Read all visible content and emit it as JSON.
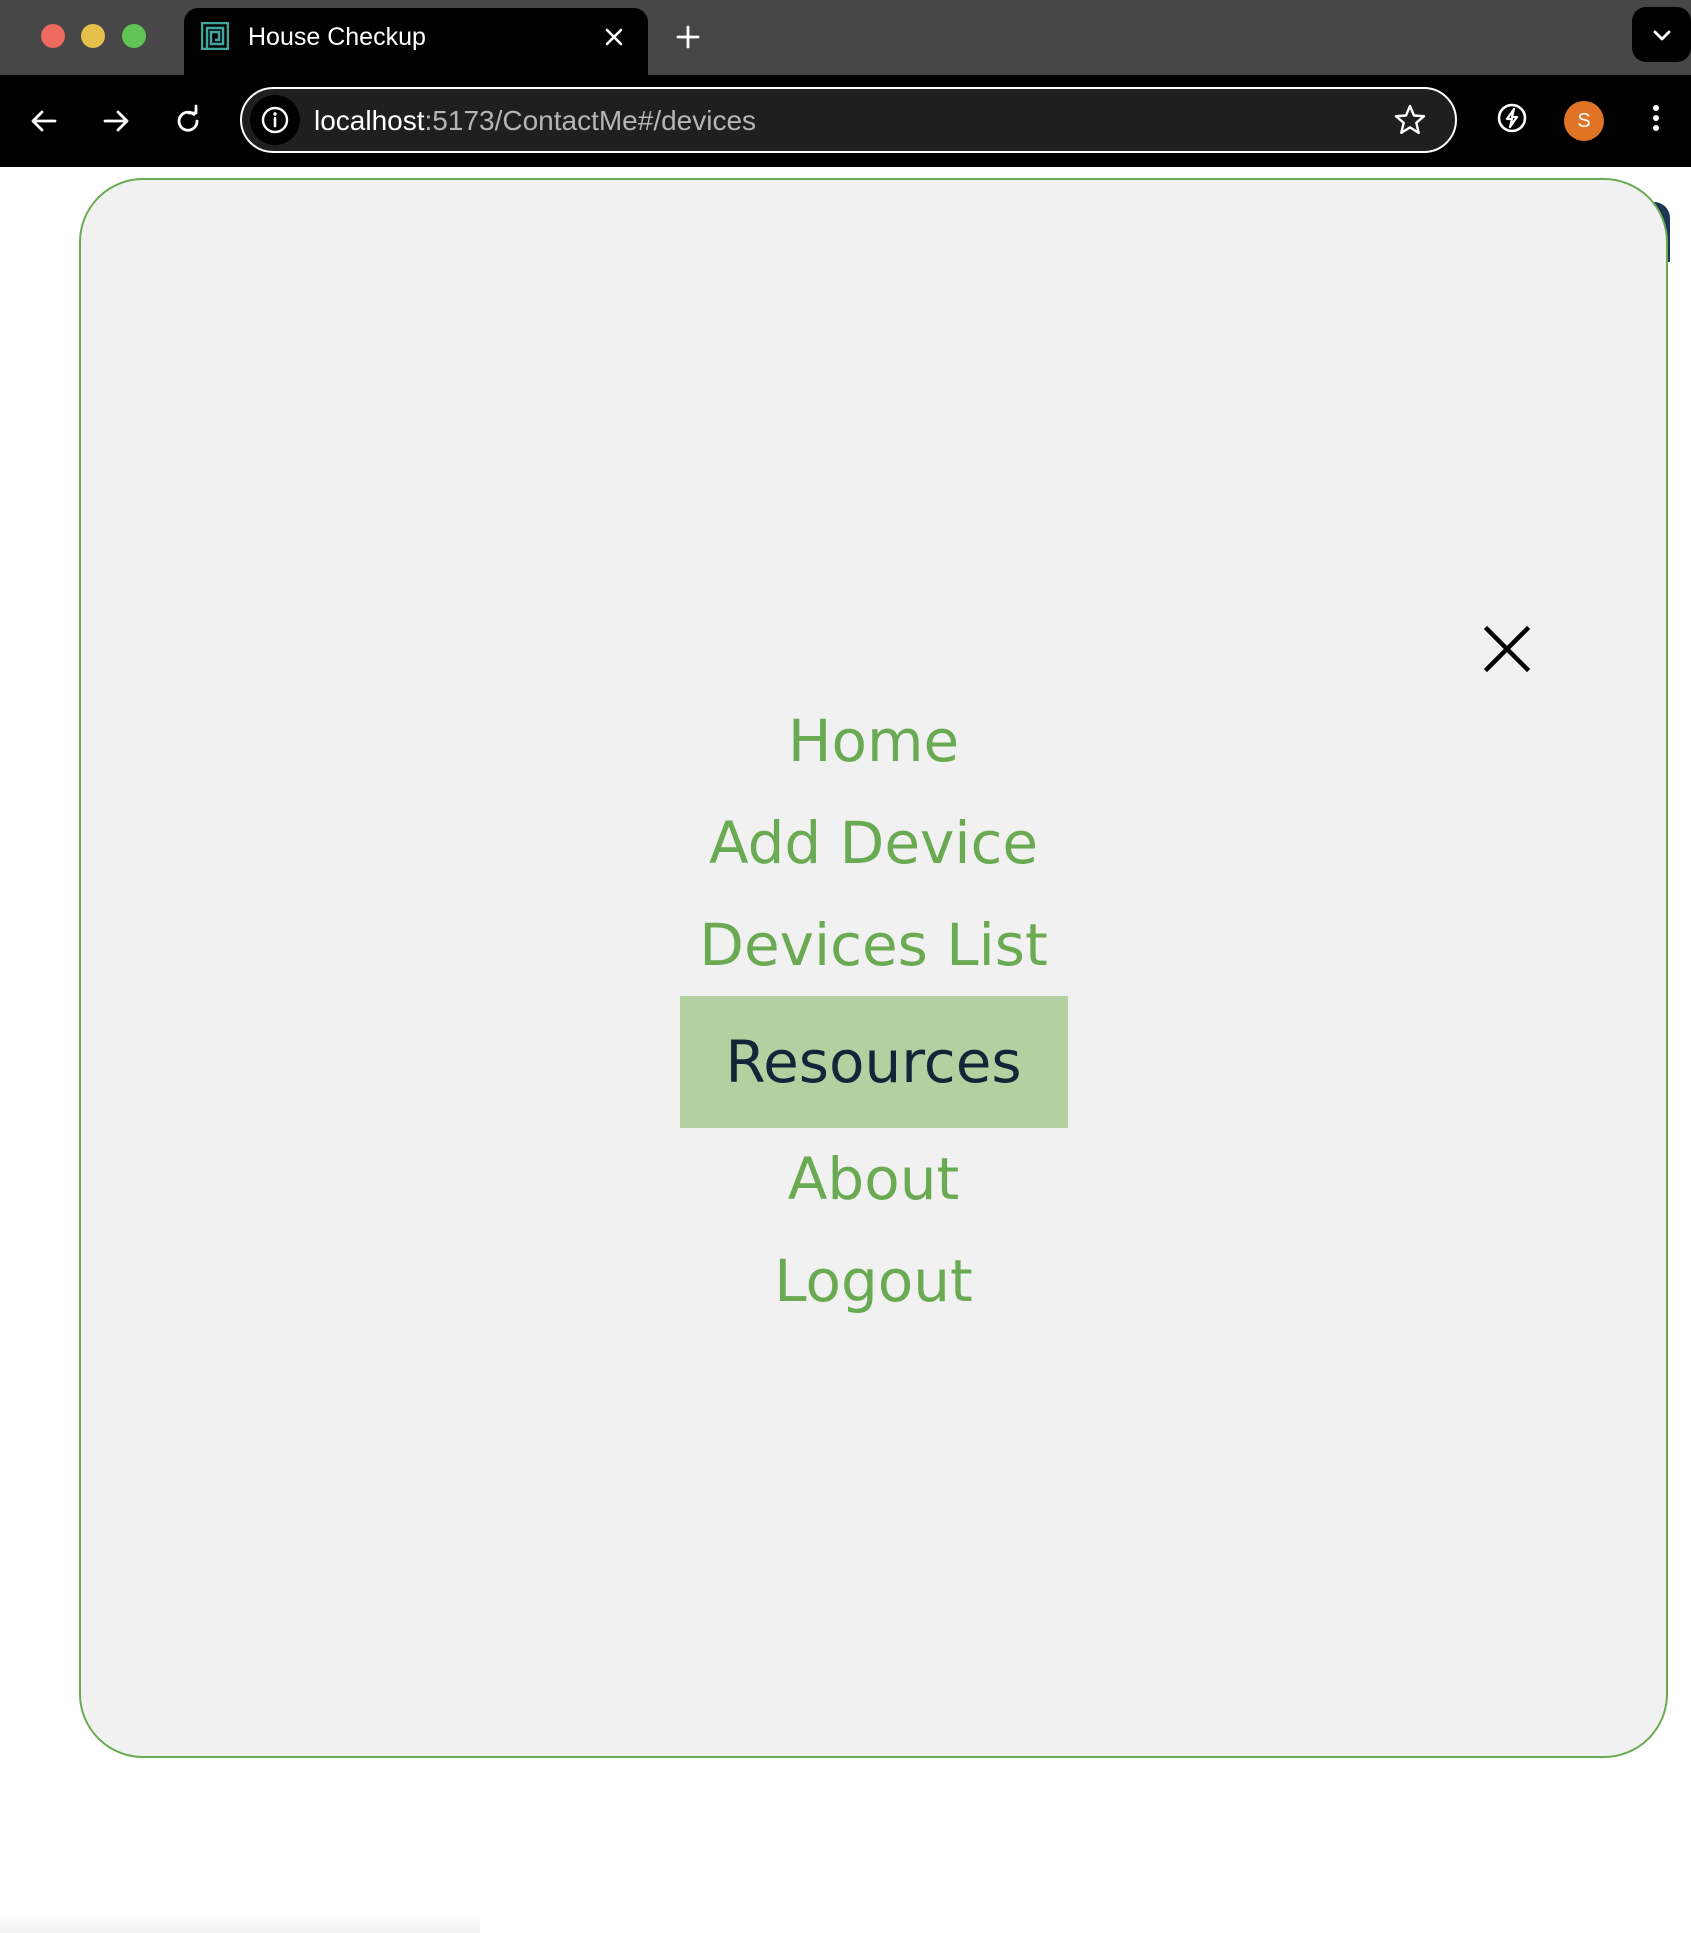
{
  "browser": {
    "tab": {
      "title": "House Checkup",
      "favicon": "maze-favicon-icon"
    },
    "address_bar": {
      "host": "localhost",
      "path": ":5173/ContactMe#/devices"
    },
    "profile": {
      "initial": "S",
      "color": "#e07325"
    }
  },
  "menu": {
    "close_icon": "close-icon",
    "items": [
      {
        "label": "Home",
        "active": false
      },
      {
        "label": "Add Device",
        "active": false
      },
      {
        "label": "Devices List",
        "active": false
      },
      {
        "label": "Resources",
        "active": true
      },
      {
        "label": "About",
        "active": false
      },
      {
        "label": "Logout",
        "active": false
      }
    ]
  },
  "colors": {
    "accent_green": "#6aaa52",
    "active_background": "#b3d1a0",
    "active_text": "#12263a",
    "overlay_background": "#f1f1f1"
  }
}
